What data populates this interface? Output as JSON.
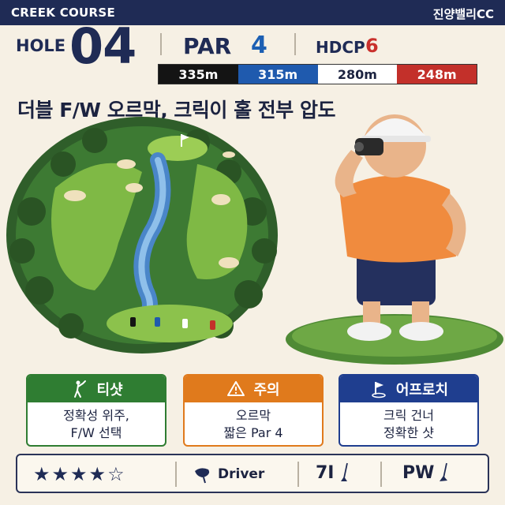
{
  "header": {
    "course_name": "CREEK COURSE",
    "club_name": "진양밸리CC"
  },
  "hole": {
    "label": "HOLE",
    "number": "04",
    "par_label": "PAR",
    "par": "4",
    "hdcp_label": "HDCP",
    "hdcp": "6"
  },
  "tees": [
    {
      "distance": "335m",
      "color": "#141414"
    },
    {
      "distance": "315m",
      "color": "#1f5aae"
    },
    {
      "distance": "280m",
      "color": "#ffffff"
    },
    {
      "distance": "248m",
      "color": "#c3302a"
    }
  ],
  "headline": "더블 F/W 오르막, 크릭이 홀 전부 압도",
  "cards": {
    "tee_shot": {
      "title": "티샷",
      "icon": "golfer-icon",
      "line1": "정확성 위주,",
      "line2": "F/W 선택",
      "color": "#2f7d32"
    },
    "caution": {
      "title": "주의",
      "icon": "warning-icon",
      "line1": "오르막",
      "line2": "짧은 Par 4",
      "color": "#e07a1c"
    },
    "approach": {
      "title": "어프로치",
      "icon": "flag-icon",
      "line1": "크릭 건너",
      "line2": "정확한 샷",
      "color": "#1f3e8f"
    }
  },
  "bottom_bar": {
    "rating": {
      "filled": 4,
      "total": 5,
      "display": "★★★★☆"
    },
    "clubs": [
      {
        "label": "Driver",
        "icon": "driver-icon"
      },
      {
        "label": "7I",
        "icon": "iron-icon"
      },
      {
        "label": "PW",
        "icon": "wedge-icon"
      }
    ]
  }
}
